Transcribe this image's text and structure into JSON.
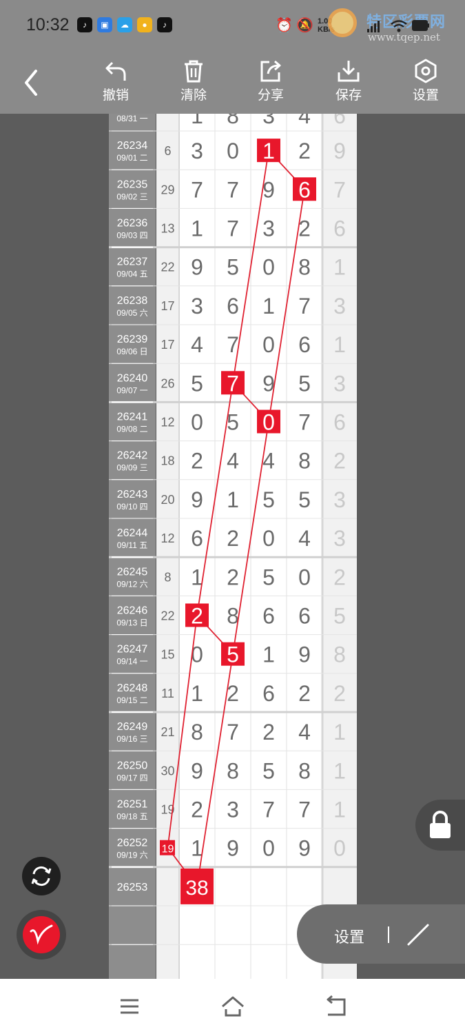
{
  "status_bar": {
    "time": "10:32",
    "net_speed_top": "1.00",
    "net_speed_unit": "KB/s",
    "apps": [
      "tiktok-icon",
      "messenger-icon",
      "cloud-icon",
      "notes-icon",
      "tiktok-icon"
    ],
    "icons": [
      "alarm-icon",
      "mute-icon",
      "signal-icon",
      "wifi-icon",
      "battery-icon"
    ]
  },
  "watermark": {
    "title": "特区彩票网",
    "url": "www.tqep.net"
  },
  "toolbar": {
    "back_icon": "back-arrow-icon",
    "buttons": [
      {
        "label": "撤销",
        "icon": "undo-icon"
      },
      {
        "label": "清除",
        "icon": "trash-icon"
      },
      {
        "label": "分享",
        "icon": "share-icon"
      },
      {
        "label": "保存",
        "icon": "download-icon"
      },
      {
        "label": "设置",
        "icon": "settings-hex-icon"
      }
    ]
  },
  "chart_data": {
    "type": "table",
    "partial_top_row": {
      "date": "08/31 一",
      "digits": [
        1,
        8,
        3,
        4
      ],
      "sum_tail": 6
    },
    "rows": [
      {
        "issue": "26234",
        "date": "09/01 二",
        "span": 6,
        "digits": [
          3,
          0,
          1,
          2
        ],
        "sum_tail": 9,
        "marked_col": 2
      },
      {
        "issue": "26235",
        "date": "09/02 三",
        "span": 29,
        "digits": [
          7,
          7,
          9,
          6
        ],
        "sum_tail": 7,
        "marked_col": 3
      },
      {
        "issue": "26236",
        "date": "09/03 四",
        "span": 13,
        "digits": [
          1,
          7,
          3,
          2
        ],
        "sum_tail": 6
      },
      {
        "issue": "26237",
        "date": "09/04 五",
        "span": 22,
        "digits": [
          9,
          5,
          0,
          8
        ],
        "sum_tail": 1
      },
      {
        "issue": "26238",
        "date": "09/05 六",
        "span": 17,
        "digits": [
          3,
          6,
          1,
          7
        ],
        "sum_tail": 3
      },
      {
        "issue": "26239",
        "date": "09/06 日",
        "span": 17,
        "digits": [
          4,
          7,
          0,
          6
        ],
        "sum_tail": 1
      },
      {
        "issue": "26240",
        "date": "09/07 一",
        "span": 26,
        "digits": [
          5,
          7,
          9,
          5
        ],
        "sum_tail": 3,
        "marked_col": 1
      },
      {
        "issue": "26241",
        "date": "09/08 二",
        "span": 12,
        "digits": [
          0,
          5,
          0,
          7
        ],
        "sum_tail": 6,
        "marked_col": 2
      },
      {
        "issue": "26242",
        "date": "09/09 三",
        "span": 18,
        "digits": [
          2,
          4,
          4,
          8
        ],
        "sum_tail": 2
      },
      {
        "issue": "26243",
        "date": "09/10 四",
        "span": 20,
        "digits": [
          9,
          1,
          5,
          5
        ],
        "sum_tail": 3
      },
      {
        "issue": "26244",
        "date": "09/11 五",
        "span": 12,
        "digits": [
          6,
          2,
          0,
          4
        ],
        "sum_tail": 3
      },
      {
        "issue": "26245",
        "date": "09/12 六",
        "span": 8,
        "digits": [
          1,
          2,
          5,
          0
        ],
        "sum_tail": 2
      },
      {
        "issue": "26246",
        "date": "09/13 日",
        "span": 22,
        "digits": [
          2,
          8,
          6,
          6
        ],
        "sum_tail": 5,
        "marked_col": 0
      },
      {
        "issue": "26247",
        "date": "09/14 一",
        "span": 15,
        "digits": [
          0,
          5,
          1,
          9
        ],
        "sum_tail": 8,
        "marked_col": 1
      },
      {
        "issue": "26248",
        "date": "09/15 二",
        "span": 11,
        "digits": [
          1,
          2,
          6,
          2
        ],
        "sum_tail": 2
      },
      {
        "issue": "26249",
        "date": "09/16 三",
        "span": 21,
        "digits": [
          8,
          7,
          2,
          4
        ],
        "sum_tail": 1
      },
      {
        "issue": "26250",
        "date": "09/17 四",
        "span": 30,
        "digits": [
          9,
          8,
          5,
          8
        ],
        "sum_tail": 1
      },
      {
        "issue": "26251",
        "date": "09/18 五",
        "span": 19,
        "digits": [
          2,
          3,
          7,
          7
        ],
        "sum_tail": 1
      },
      {
        "issue": "26252",
        "date": "09/19 六",
        "span": 19,
        "digits": [
          1,
          9,
          0,
          9
        ],
        "sum_tail": 0,
        "marked_span": true
      }
    ],
    "next_row": {
      "issue": "26253",
      "marked_value": "38"
    },
    "colors": {
      "mark": "#e8172b",
      "digit": "#6a6a6a",
      "faded": "#c8c8c8",
      "side": "#8d8d8d",
      "line": "#e02030"
    }
  },
  "controls": {
    "rotate_icon": "rotate-icon",
    "pen_icon": "pen-icon",
    "lock_icon": "lock-icon",
    "settings_label": "设置",
    "draw_icon": "draw-line-icon"
  },
  "nav_bar": {
    "icons": [
      "menu-icon",
      "home-icon",
      "back-icon"
    ]
  }
}
